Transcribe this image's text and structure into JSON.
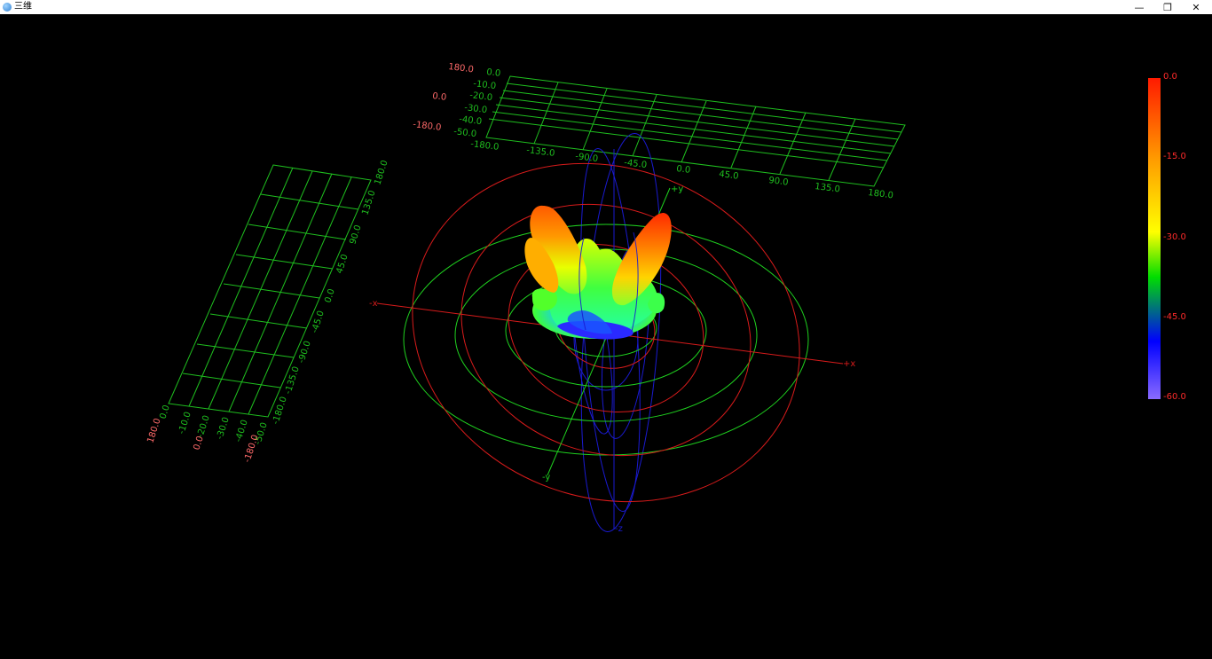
{
  "window": {
    "title": "三维",
    "minimize_glyph": "—",
    "restore_glyph": "❐",
    "close_glyph": "✕",
    "icon": "app-globe-icon"
  },
  "colorbar": {
    "labels": [
      "0.0",
      "-15.0",
      "-30.0",
      "-45.0",
      "-60.0"
    ],
    "stops": [
      "#ff1a00",
      "#ff9a00",
      "#ffff00",
      "#00dd00",
      "#0000ff",
      "#8a6bff"
    ]
  },
  "back_panel": {
    "x_ticks": [
      "-180.0",
      "-135.0",
      "-90.0",
      "-45.0",
      "0.0",
      "45.0",
      "90.0",
      "135.0",
      "180.0"
    ],
    "db_ticks": [
      "0.0",
      "-10.0",
      "-20.0",
      "-30.0",
      "-40.0",
      "-50.0"
    ],
    "side_labels": [
      "180.0",
      "0.0",
      "-180.0"
    ]
  },
  "side_panel": {
    "y_ticks": [
      "180.0",
      "135.0",
      "90.0",
      "45.0",
      "0.0",
      "-45.0",
      "-90.0",
      "-135.0",
      "-180.0"
    ],
    "db_ticks": [
      "0.0",
      "-10.0",
      "-20.0",
      "-30.0",
      "-40.0",
      "-50.0"
    ],
    "side_labels": [
      "180.0",
      "0.0",
      "-180.0"
    ]
  },
  "axes": {
    "plus_x": "+x",
    "minus_x": "-x",
    "plus_y": "+y",
    "minus_y": "-y",
    "minus_z": "-z"
  },
  "colors": {
    "grid": "#1fbf1f",
    "label_red": "#ff6a6a",
    "ring_red": "#d81b1b",
    "ring_green": "#1fd11f",
    "ring_blue": "#1a1ad0"
  }
}
